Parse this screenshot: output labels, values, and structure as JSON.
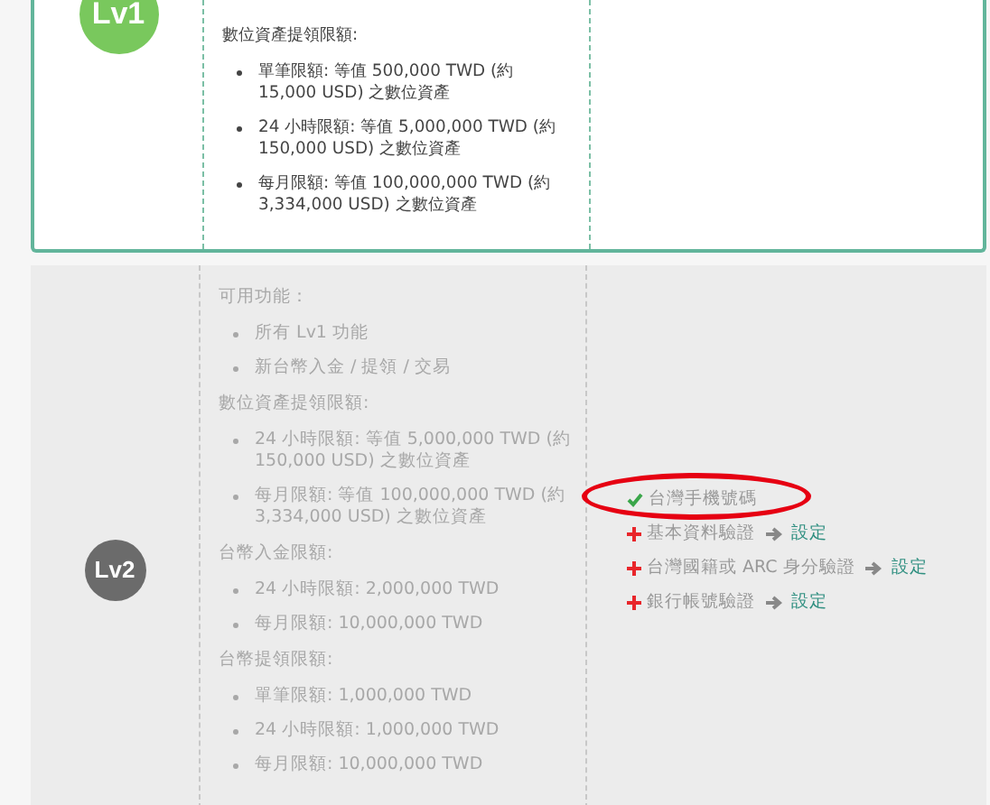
{
  "levels": [
    {
      "badge": "Lv1",
      "active": true,
      "sections": [
        {
          "heading": "數位資產提領限額:",
          "items": [
            "單筆限額: 等值 500,000 TWD (約 15,000 USD) 之數位資產",
            "24 小時限額: 等值 5,000,000 TWD (約 150,000 USD) 之數位資產",
            "每月限額: 等值 100,000,000 TWD (約 3,334,000 USD) 之數位資產"
          ]
        }
      ]
    },
    {
      "badge": "Lv2",
      "active": false,
      "sections": [
        {
          "heading": "可用功能：",
          "items": [
            "所有 Lv1 功能",
            "新台幣入金 / 提領 / 交易"
          ]
        },
        {
          "heading": "數位資產提領限額:",
          "items": [
            "24 小時限額: 等值 5,000,000 TWD (約 150,000 USD) 之數位資產",
            "每月限額: 等值 100,000,000 TWD (約 3,334,000 USD) 之數位資產"
          ]
        },
        {
          "heading": "台幣入金限額:",
          "items": [
            "24 小時限額: 2,000,000 TWD",
            "每月限額: 10,000,000 TWD"
          ]
        },
        {
          "heading": "台幣提領限額:",
          "items": [
            "單筆限額: 1,000,000 TWD",
            "24 小時限額: 1,000,000 TWD",
            "每月限額: 10,000,000 TWD"
          ]
        }
      ],
      "requirements": [
        {
          "label": "台灣手機號碼",
          "done": true,
          "highlighted": true
        },
        {
          "label": "基本資料驗證",
          "done": false,
          "highlighted": false,
          "action": "設定"
        },
        {
          "label": "台灣國籍或 ARC 身分驗證",
          "done": false,
          "highlighted": false,
          "action": "設定"
        },
        {
          "label": "銀行帳號驗證",
          "done": false,
          "highlighted": false,
          "action": "設定"
        }
      ]
    }
  ]
}
